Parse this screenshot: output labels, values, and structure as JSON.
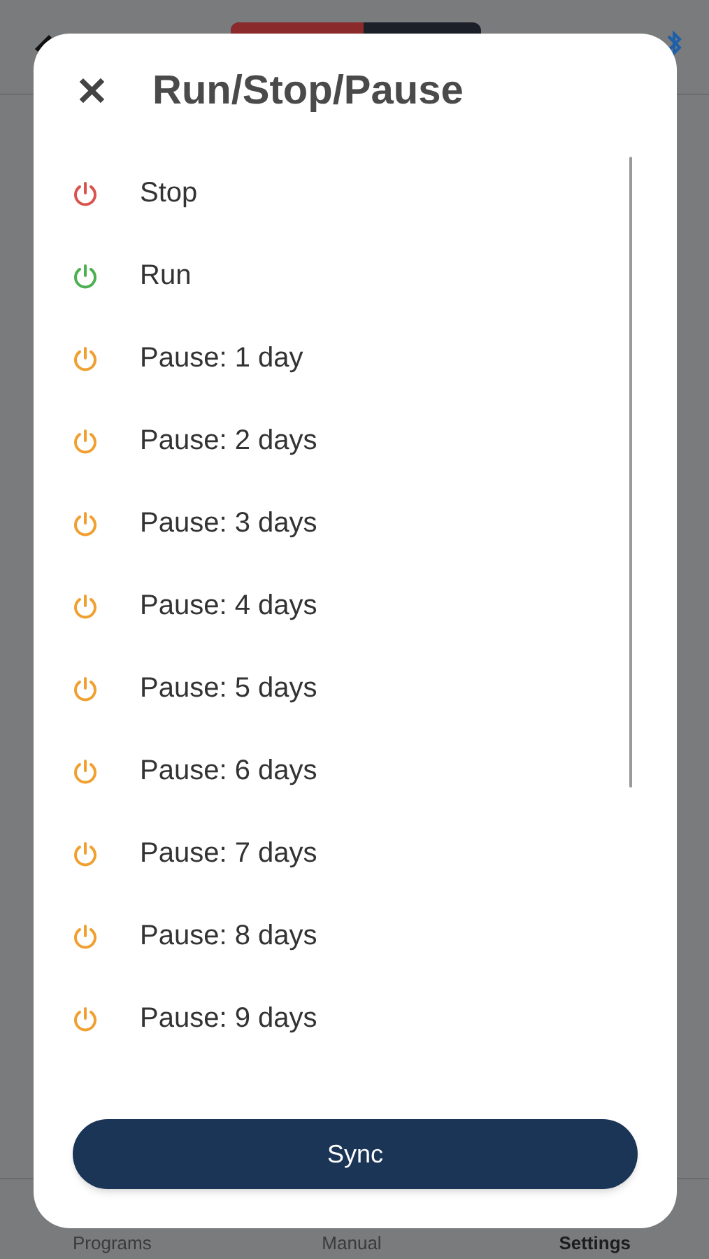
{
  "tab_bar": {
    "tabs": [
      {
        "label": "Programs",
        "selected": false
      },
      {
        "label": "Manual",
        "selected": false
      },
      {
        "label": "Settings",
        "selected": true
      }
    ]
  },
  "dialog": {
    "close": "✕",
    "title": "Run/Stop/Pause",
    "options": [
      {
        "label": "Stop",
        "color": "#d9534f"
      },
      {
        "label": "Run",
        "color": "#4caf50"
      },
      {
        "label": "Pause: 1 day",
        "color": "#f0a030"
      },
      {
        "label": "Pause: 2 days",
        "color": "#f0a030"
      },
      {
        "label": "Pause: 3 days",
        "color": "#f0a030"
      },
      {
        "label": "Pause: 4 days",
        "color": "#f0a030"
      },
      {
        "label": "Pause: 5 days",
        "color": "#f0a030"
      },
      {
        "label": "Pause: 6 days",
        "color": "#f0a030"
      },
      {
        "label": "Pause: 7 days",
        "color": "#f0a030"
      },
      {
        "label": "Pause: 8 days",
        "color": "#f0a030"
      },
      {
        "label": "Pause: 9 days",
        "color": "#f0a030"
      }
    ],
    "button": "Sync"
  }
}
